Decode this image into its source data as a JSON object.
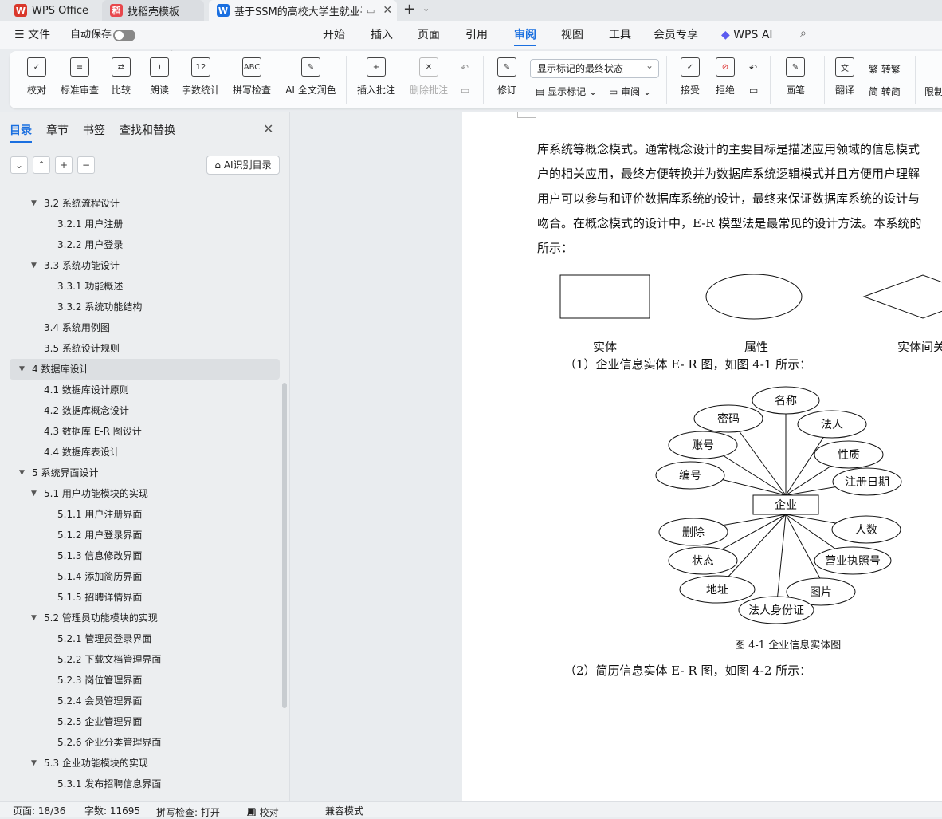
{
  "tabs": [
    {
      "label": "WPS Office",
      "icon": "wps-logo-icon",
      "color": "#d9382b"
    },
    {
      "label": "找稻壳模板",
      "icon": "docer-icon",
      "color": "#e8474c"
    },
    {
      "label": "基于SSM的高校大学生就业平",
      "icon": "word-doc-icon",
      "color": "#1a6fe0"
    }
  ],
  "menu": {
    "file": "文件",
    "autosave": "自动保存",
    "items": [
      "开始",
      "插入",
      "页面",
      "引用",
      "审阅",
      "视图",
      "工具",
      "会员专享",
      "WPS AI"
    ],
    "active": "审阅"
  },
  "ribbon": {
    "buttons": [
      "校对",
      "标准审查",
      "比较",
      "朗读",
      "字数统计",
      "拼写检查",
      "AI 全文润色",
      "插入批注",
      "删除批注",
      "修订",
      "画笔",
      "翻译"
    ],
    "markup_select": "显示标记的最终状态",
    "show_markup": "显示标记",
    "review": "审阅",
    "accept": "接受",
    "reject": "拒绝",
    "to_trad": "繁 转繁",
    "to_simp": "简 转简",
    "restrict": "限制"
  },
  "sidebar": {
    "tabs": [
      "目录",
      "章节",
      "书签",
      "查找和替换"
    ],
    "ai_button": "AI识别目录",
    "toc": [
      {
        "label": "3.2 系统流程设计",
        "level": 2,
        "arrow": true
      },
      {
        "label": "3.2.1  用户注册",
        "level": 3
      },
      {
        "label": "3.2.2  用户登录",
        "level": 3
      },
      {
        "label": "3.3 系统功能设计",
        "level": 2,
        "arrow": true
      },
      {
        "label": "3.3.1  功能概述",
        "level": 3
      },
      {
        "label": "3.3.2  系统功能结构",
        "level": 3
      },
      {
        "label": "3.4 系统用例图",
        "level": 2
      },
      {
        "label": "3.5 系统设计规则",
        "level": 2
      },
      {
        "label": "4 数据库设计",
        "level": 1,
        "arrow": true,
        "selected": true
      },
      {
        "label": "4.1 数据库设计原则",
        "level": 2
      },
      {
        "label": "4.2 数据库概念设计",
        "level": 2
      },
      {
        "label": "4.3 数据库 E-R 图设计",
        "level": 2
      },
      {
        "label": "4.4 数据库表设计",
        "level": 2
      },
      {
        "label": "5 系统界面设计",
        "level": 1,
        "arrow": true
      },
      {
        "label": "5.1 用户功能模块的实现",
        "level": 2,
        "arrow": true
      },
      {
        "label": "5.1.1  用户注册界面",
        "level": 3
      },
      {
        "label": "5.1.2 用户登录界面",
        "level": 3
      },
      {
        "label": "5.1.3 信息修改界面",
        "level": 3
      },
      {
        "label": "5.1.4 添加简历界面",
        "level": 3
      },
      {
        "label": "5.1.5 招聘详情界面",
        "level": 3
      },
      {
        "label": "5.2 管理员功能模块的实现",
        "level": 2,
        "arrow": true
      },
      {
        "label": "5.2.1 管理员登录界面",
        "level": 3
      },
      {
        "label": "5.2.2 下载文档管理界面",
        "level": 3
      },
      {
        "label": "5.2.3 岗位管理界面",
        "level": 3
      },
      {
        "label": "5.2.4 会员管理界面",
        "level": 3
      },
      {
        "label": "5.2.5 企业管理界面",
        "level": 3
      },
      {
        "label": "5.2.6 企业分类管理界面",
        "level": 3
      },
      {
        "label": "5.3 企业功能模块的实现",
        "level": 2,
        "arrow": true
      },
      {
        "label": "5.3.1 发布招聘信息界面",
        "level": 3
      }
    ]
  },
  "document": {
    "paragraphs": [
      "库系统等概念模式。通常概念设计的主要目标是描述应用领域的信息模式",
      "户的相关应用，最终方便转换并为数据库系统逻辑模式并且方便用户理解",
      "用户可以参与和评价数据库系统的设计，最终来保证数据库系统的设计与",
      "吻合。在概念模式的设计中，E-R 模型法是最常见的设计方法。本系统的",
      "所示："
    ],
    "shape_labels": [
      "实体",
      "属性",
      "实体间关"
    ],
    "item1": "（1）企业信息实体 E- R 图，如图 4-1 所示：",
    "er": {
      "entity": "企业",
      "attributes": [
        "名称",
        "密码",
        "法人",
        "账号",
        "性质",
        "编号",
        "注册日期",
        "删除",
        "人数",
        "状态",
        "营业执照号",
        "地址",
        "图片",
        "法人身份证"
      ]
    },
    "caption": "图 4-1 企业信息实体图",
    "item2": "（2）简历信息实体 E- R 图，如图 4-2 所示："
  },
  "status": {
    "page": "页面: 18/36",
    "words": "字数: 11695",
    "spell": "拼写检查: 打开",
    "ai": "AI 校对",
    "compat": "兼容模式"
  }
}
